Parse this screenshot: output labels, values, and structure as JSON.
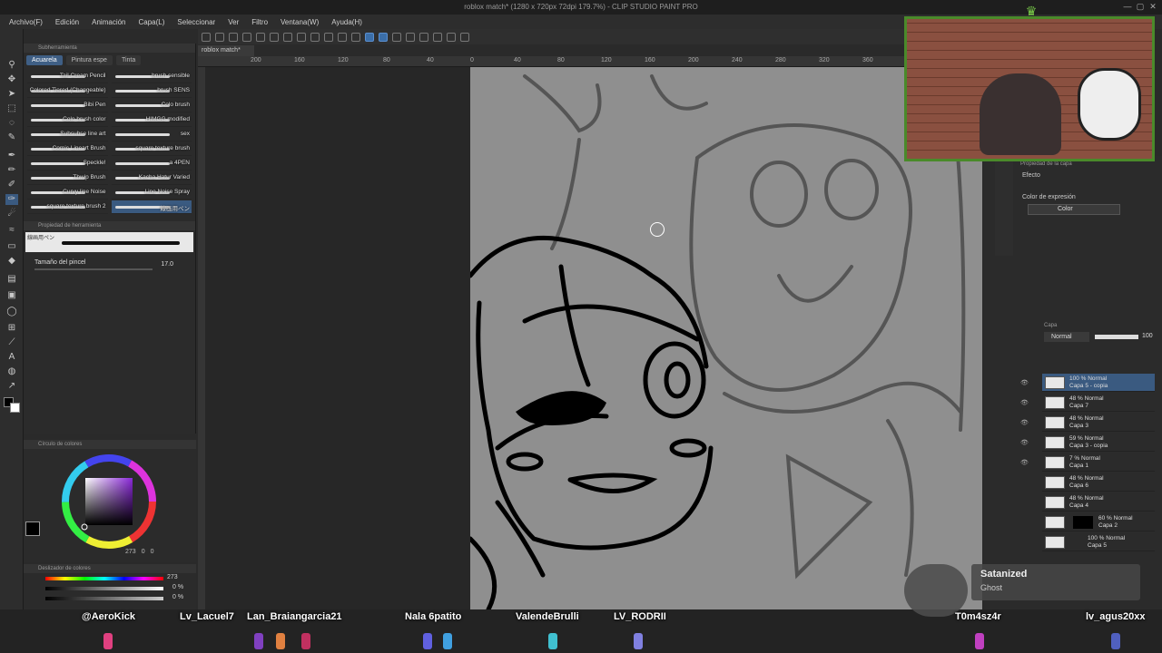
{
  "window": {
    "title": "roblox match* (1280 x 720px 72dpi 179.7%) - CLIP STUDIO PAINT PRO",
    "document_tab": "roblox match*"
  },
  "menu": [
    "Archivo(F)",
    "Edición",
    "Animación",
    "Capa(L)",
    "Seleccionar",
    "Ver",
    "Filtro",
    "Ventana(W)",
    "Ayuda(H)"
  ],
  "left_panel": {
    "header": "Subherramienta",
    "tabs": [
      "Acuarela",
      "Pintura espe",
      "Tinta"
    ],
    "brushes_left": [
      "Tail Cream Pencil",
      "Colored Tiered (Changeable)",
      "Bibi Pen",
      "Colo brush color",
      "Subsubse line art",
      "Comic Lineart Brush",
      "Speckle!",
      "Thwip Brush",
      "Curvy line Noise",
      "square texture brush 2"
    ],
    "brushes_right": [
      "brush sensible",
      "brush SENS",
      "Colo brush",
      "HIMGG modified",
      "sex",
      "square texture brush",
      "a 4PEN",
      "Kacha Hatur Varied",
      "Line Noise Spray",
      "線画用ペン"
    ],
    "tool_property_header": "Propiedad de herramienta",
    "tool_property_name": "線画用ペン",
    "brush_size_label": "Tamaño del pincel",
    "brush_size_value": "17.0"
  },
  "color_panel": {
    "header": "Círculo de colores",
    "hue": "273",
    "sat": "0",
    "val": "0",
    "slider_header": "Deslizador de colores",
    "slider_values": [
      "273",
      "0 %",
      "0 %"
    ]
  },
  "ruler_labels": [
    "200",
    "160",
    "120",
    "80",
    "40",
    "0",
    "40",
    "80",
    "120",
    "160",
    "200",
    "240",
    "280",
    "320",
    "360"
  ],
  "right_panel": {
    "layer_property_header": "Propiedad de la capa",
    "effect_label": "Efecto",
    "expression_color_label": "Color de expresión",
    "expression_color_value": "Color",
    "layer_header": "Capa",
    "blend_mode": "Normal",
    "opacity": "100",
    "layers": [
      {
        "mode": "100 % Normal",
        "name": "Capa 5 - copia"
      },
      {
        "mode": "48 % Normal",
        "name": "Capa 7"
      },
      {
        "mode": "48 % Normal",
        "name": "Capa 3"
      },
      {
        "mode": "59 % Normal",
        "name": "Capa 3 - copia"
      },
      {
        "mode": "7 % Normal",
        "name": "Capa 1"
      },
      {
        "mode": "48 % Normal",
        "name": "Capa 6"
      },
      {
        "mode": "48 % Normal",
        "name": "Capa 4"
      },
      {
        "mode": "60 % Normal",
        "name": "Capa 2"
      },
      {
        "mode": "100 % Normal",
        "name": "Capa 5"
      }
    ]
  },
  "overlay": {
    "notification_title": "Satanized",
    "notification_sub": "Ghost",
    "chat_names": [
      "@AeroKick",
      "Lv_Lacuel7",
      "Lan_Braiangarcia21",
      "Nala 6patito",
      "ValendeBrulli",
      "LV_RODRII",
      "T0m4sz4r",
      "lv_agus20xx"
    ]
  },
  "colors": {
    "accent": "#3a5a80",
    "webcam_border": "#4a8a2a",
    "page": "#8f8f8f"
  }
}
